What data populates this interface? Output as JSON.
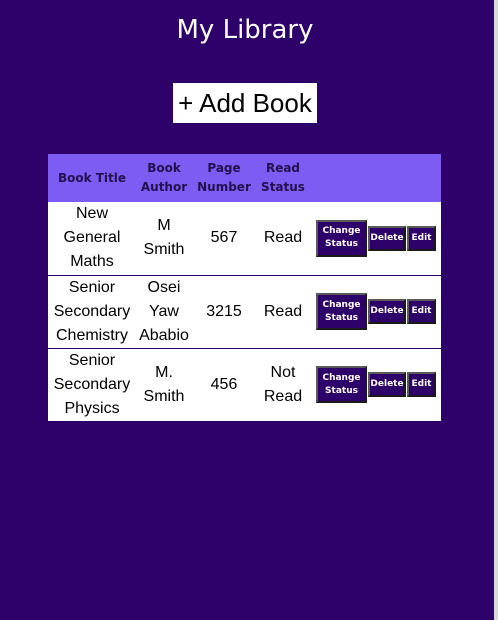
{
  "page": {
    "title": "My Library",
    "add_book_label": "+ Add Book"
  },
  "table": {
    "headers": {
      "title": "Book Title",
      "author": "Book Author",
      "pages": "Page Number",
      "status": "Read Status"
    },
    "rows": [
      {
        "title": "New General Maths",
        "author": "M Smith",
        "pages": "567",
        "status": "Read"
      },
      {
        "title": "Senior Secondary Chemistry",
        "author": "Osei Yaw Ababio",
        "pages": "3215",
        "status": "Read"
      },
      {
        "title": "Senior Secondary Physics",
        "author": "M. Smith",
        "pages": "456",
        "status": "Not Read"
      }
    ],
    "actions": {
      "change_status_label": "Change Status",
      "delete_label": "Delete",
      "edit_label": "Edit"
    }
  },
  "colors": {
    "background": "#2e016a",
    "header_row": "#7c5cf2",
    "button": "#2e016a"
  }
}
